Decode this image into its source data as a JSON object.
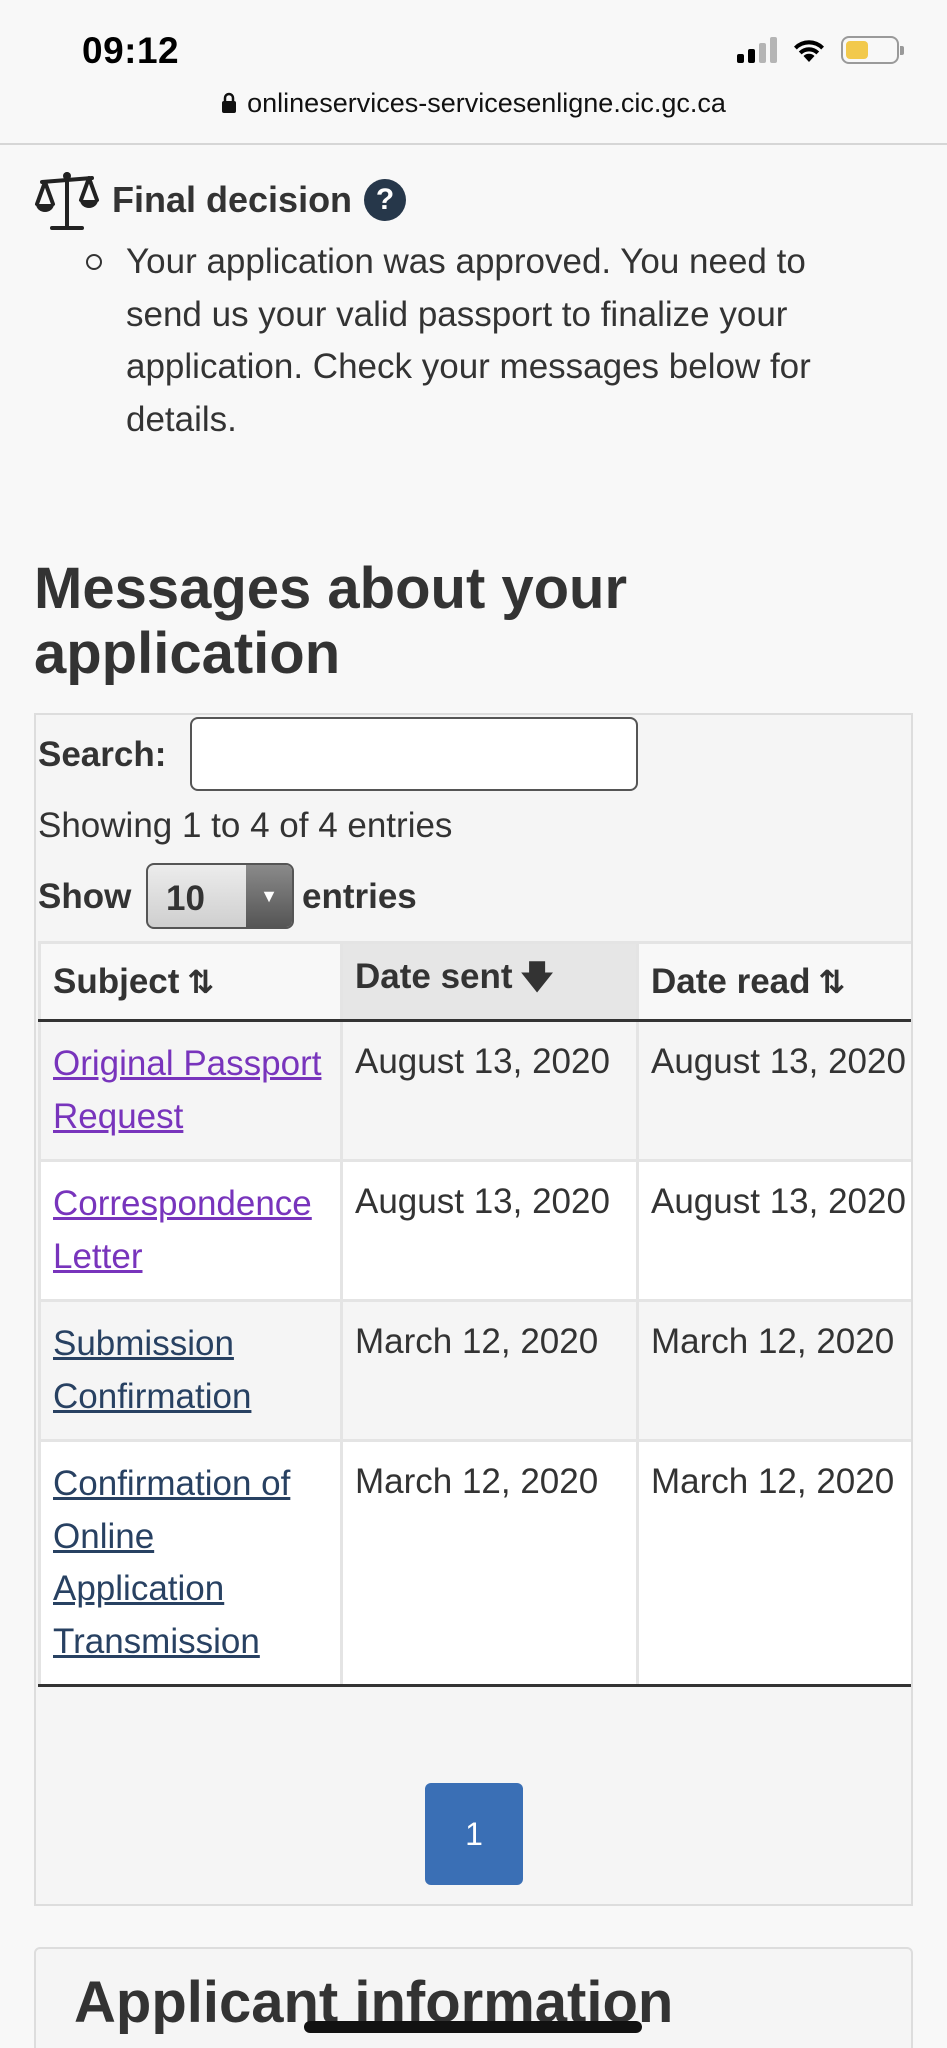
{
  "status_bar": {
    "time": "09:12",
    "url": "onlineservices-servicesenligne.cic.gc.ca"
  },
  "decision": {
    "title": "Final decision",
    "help_label": "?",
    "text": "Your application was approved. You need to send us your valid passport to finalize your application. Check your messages below for details."
  },
  "messages": {
    "heading": "Messages about your application",
    "search_label": "Search:",
    "search_value": "",
    "info": "Showing 1 to 4 of 4 entries",
    "show_label": "Show",
    "length_value": "10",
    "entries_label": "entries",
    "columns": [
      "Subject",
      "Date sent",
      "Date read"
    ],
    "rows": [
      {
        "subject": "Original Passport Request",
        "date_sent": "August 13, 2020",
        "date_read": "August 13, 2020"
      },
      {
        "subject": "Correspondence Letter",
        "date_sent": "August 13, 2020",
        "date_read": "August 13, 2020"
      },
      {
        "subject": "Submission Confirmation",
        "date_sent": "March 12, 2020",
        "date_read": "March 12, 2020"
      },
      {
        "subject": "Confirmation of Online Application Transmission",
        "date_sent": "March 12, 2020",
        "date_read": "March 12, 2020"
      }
    ],
    "page": "1"
  },
  "applicant": {
    "heading": "Applicant information"
  },
  "colors": {
    "link_visited": "#7834bc",
    "link": "#284162",
    "page_button": "#3a6fb5",
    "help_icon": "#26374a"
  }
}
